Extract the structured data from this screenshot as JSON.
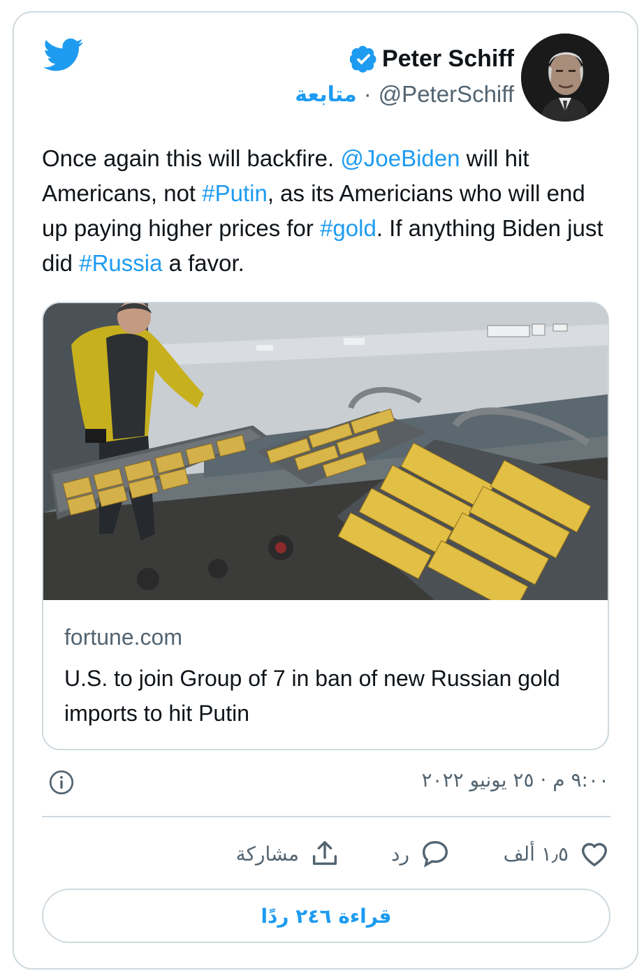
{
  "tweet": {
    "display_name": "Peter Schiff",
    "handle": "@PeterSchiff",
    "separator": "·",
    "follow_label": "متابعة",
    "text_parts": {
      "p1": "Once again this will backfire. ",
      "mention": "@JoeBiden",
      "p2": " will hit Americans, not ",
      "tag_putin": "#Putin",
      "p3": ", as its Americians who will end up paying higher prices for ",
      "tag_gold": "#gold",
      "p4": ". If anything Biden just did ",
      "tag_russia": "#Russia",
      "p5": " a favor."
    },
    "timestamp": "٩:٠٠ م · ٢٥ يونيو ٢٠٢٢",
    "link_card": {
      "domain": "fortune.com",
      "title": "U.S. to join Group of 7 in ban of new Russian gold imports to hit Putin"
    },
    "actions": {
      "like_count": "١٫٥ ألف",
      "reply_label": "رد",
      "share_label": "مشاركة"
    },
    "read_replies_label": "قراءة ٢٤٦ ردًا"
  },
  "colors": {
    "accent": "#1d9bf0",
    "text_primary": "#0f1419",
    "text_secondary": "#536471",
    "border": "#cfd9de"
  },
  "icons": {
    "logo": "twitter-bird-icon",
    "verified": "verified-badge-icon",
    "info": "info-icon",
    "like": "heart-icon",
    "reply": "speech-bubble-icon",
    "share": "share-upload-icon"
  }
}
